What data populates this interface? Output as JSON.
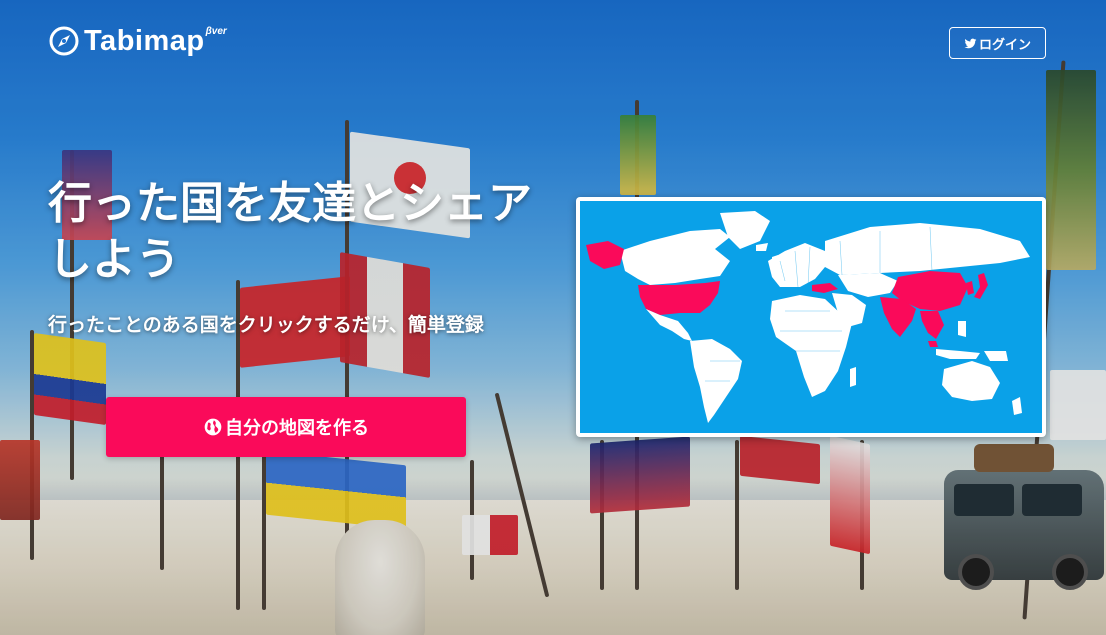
{
  "header": {
    "logo_text": "Tabimap",
    "logo_badge": "βver",
    "login_label": "ログイン"
  },
  "hero": {
    "title_line1": "行った国を友達とシェア",
    "title_line2": "しよう",
    "subtitle": "行ったことのある国をクリックするだけ、簡単登録",
    "cta_label": "自分の地図を作る"
  },
  "map": {
    "ocean_color": "#0aa1e8",
    "land_color": "#ffffff",
    "visited_color": "#fa0a5a",
    "visited_countries": [
      "United States",
      "Alaska (US)",
      "Turkey",
      "China",
      "India",
      "Japan",
      "South Korea",
      "Thailand",
      "Vietnam",
      "Malaysia",
      "Cambodia",
      "Laos",
      "Myanmar",
      "Nepal",
      "Bangladesh"
    ]
  },
  "colors": {
    "accent": "#fa0a5a",
    "text_on_image": "#ffffff"
  },
  "icons": {
    "logo": "compass-icon",
    "login": "twitter-bird-icon",
    "cta": "globe-icon"
  }
}
